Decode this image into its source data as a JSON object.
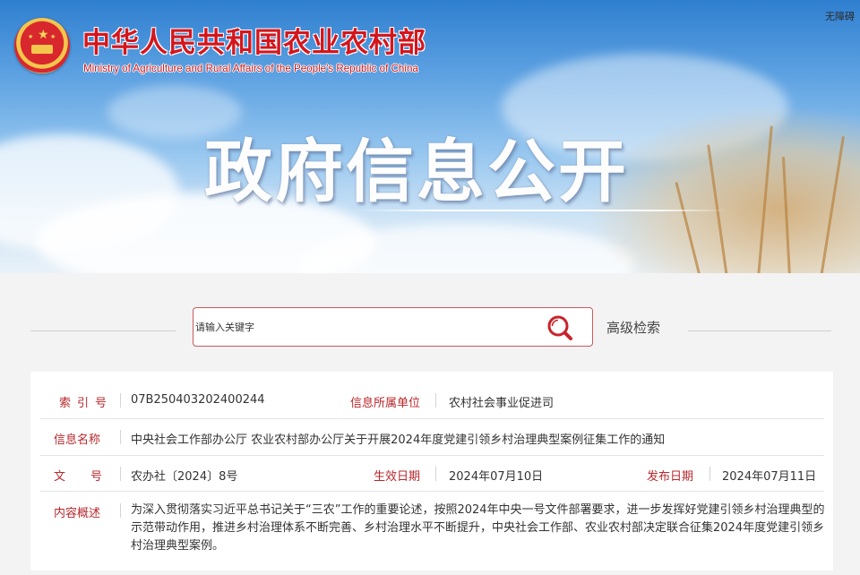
{
  "header": {
    "ministry_cn": "中华人民共和国农业农村部",
    "ministry_en": "Ministry of Agriculture and Rural Affairs of the People's Republic of China",
    "accessibility_link": "无障碍",
    "banner_title": "政府信息公开",
    "emblem_icon": "national-emblem-icon"
  },
  "search": {
    "placeholder": "请输入关键字",
    "button_icon": "search-icon",
    "advanced_label": "高级检索",
    "border_color": "#c65a5e"
  },
  "info": {
    "index_label": "索引号",
    "index_value": "07B250403202400244",
    "unit_label": "信息所属单位",
    "unit_value": "农村社会事业促进司",
    "name_label": "信息名称",
    "name_value": "中央社会工作部办公厅 农业农村部办公厅关于开展2024年度党建引领乡村治理典型案例征集工作的通知",
    "docno_label": "文号",
    "docno_value": "农办社〔2024〕8号",
    "effective_label": "生效日期",
    "effective_value": "2024年07月10日",
    "publish_label": "发布日期",
    "publish_value": "2024年07月11日",
    "summary_label": "内容概述",
    "summary_value": "为深入贯彻落实习近平总书记关于“三农”工作的重要论述，按照2024年中央一号文件部署要求，进一步发挥好党建引领乡村治理典型的示范带动作用，推进乡村治理体系不断完善、乡村治理水平不断提升，中央社会工作部、农业农村部决定联合征集2024年度党建引领乡村治理典型案例。",
    "label_color": "#b8272c"
  }
}
